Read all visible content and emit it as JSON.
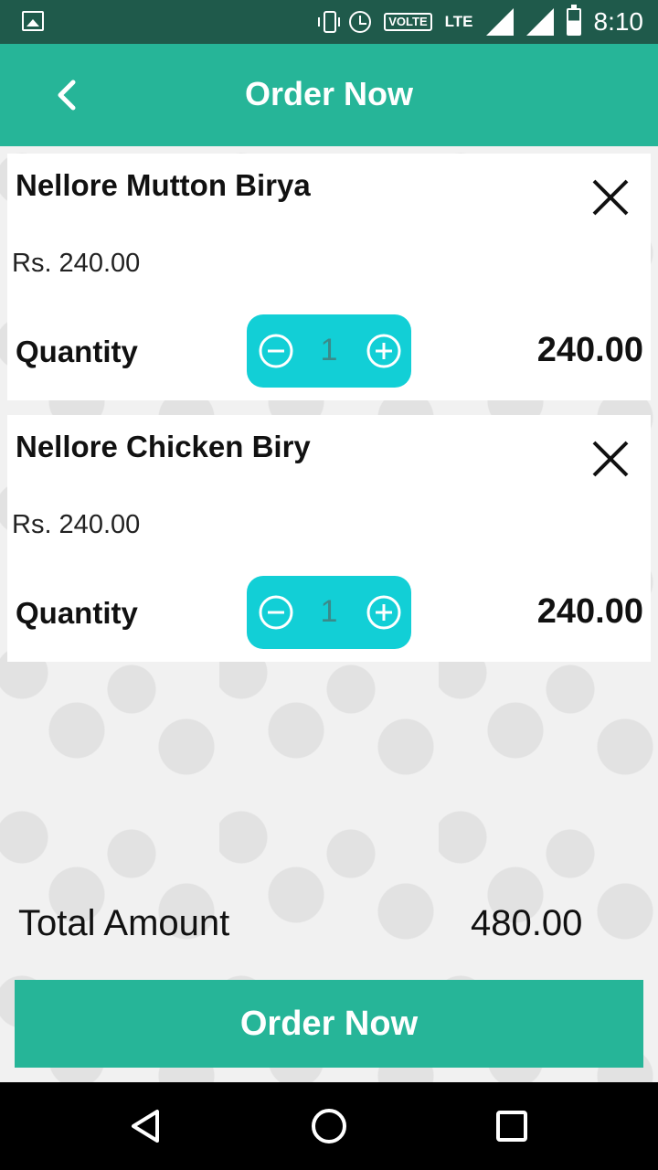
{
  "status_bar": {
    "volte": "VOLTE",
    "network": "LTE",
    "time": "8:10"
  },
  "header": {
    "title": "Order Now",
    "back_icon": "chevron-left-icon"
  },
  "cart": {
    "items": [
      {
        "name": "Nellore Mutton Birya",
        "price": "Rs. 240.00",
        "quantity_label": "Quantity",
        "quantity": "1",
        "line_total": "240.00"
      },
      {
        "name": "Nellore Chicken Biry",
        "price": "Rs. 240.00",
        "quantity_label": "Quantity",
        "quantity": "1",
        "line_total": "240.00"
      }
    ],
    "total_label": "Total Amount",
    "total_value": "480.00"
  },
  "footer": {
    "order_button": "Order Now"
  },
  "colors": {
    "primary": "#26b598",
    "status_bar": "#1f5a4b",
    "stepper": "#12cfd6"
  }
}
